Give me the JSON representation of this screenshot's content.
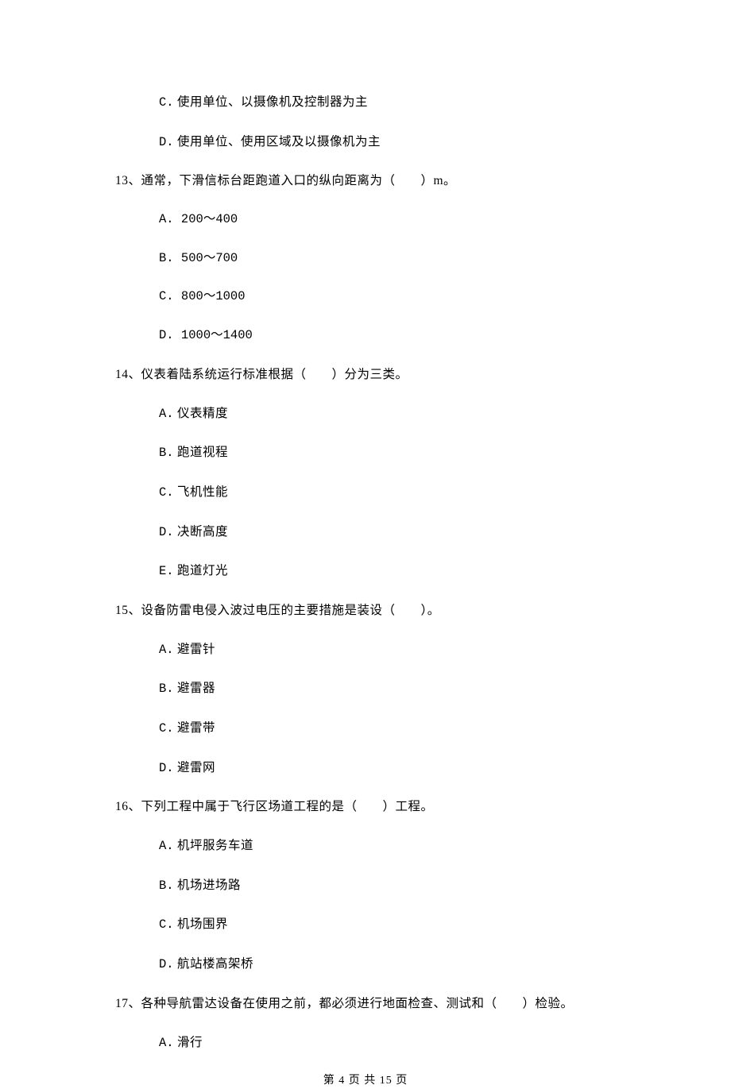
{
  "options_top": [
    {
      "label": "C.",
      "text": "使用单位、以摄像机及控制器为主"
    },
    {
      "label": "D.",
      "text": "使用单位、使用区域及以摄像机为主"
    }
  ],
  "q13": {
    "text": "13、通常，下滑信标台距跑道入口的纵向距离为（　　）m。",
    "options": [
      {
        "label": "A.",
        "text": "200～400"
      },
      {
        "label": "B.",
        "text": "500～700"
      },
      {
        "label": "C.",
        "text": "800～1000"
      },
      {
        "label": "D.",
        "text": "1000～1400"
      }
    ]
  },
  "q14": {
    "text": "14、仪表着陆系统运行标准根据（　　）分为三类。",
    "options": [
      {
        "label": "A.",
        "text": "仪表精度"
      },
      {
        "label": "B.",
        "text": "跑道视程"
      },
      {
        "label": "C.",
        "text": "飞机性能"
      },
      {
        "label": "D.",
        "text": "决断高度"
      },
      {
        "label": "E.",
        "text": "跑道灯光"
      }
    ]
  },
  "q15": {
    "text": "15、设备防雷电侵入波过电压的主要措施是装设（　　）。",
    "options": [
      {
        "label": "A.",
        "text": "避雷针"
      },
      {
        "label": "B.",
        "text": "避雷器"
      },
      {
        "label": "C.",
        "text": "避雷带"
      },
      {
        "label": "D.",
        "text": "避雷网"
      }
    ]
  },
  "q16": {
    "text": "16、下列工程中属于飞行区场道工程的是（　　）工程。",
    "options": [
      {
        "label": "A.",
        "text": "机坪服务车道"
      },
      {
        "label": "B.",
        "text": "机场进场路"
      },
      {
        "label": "C.",
        "text": "机场围界"
      },
      {
        "label": "D.",
        "text": "航站楼高架桥"
      }
    ]
  },
  "q17": {
    "text": "17、各种导航雷达设备在使用之前，都必须进行地面检查、测试和（　　）检验。",
    "options": [
      {
        "label": "A.",
        "text": "滑行"
      }
    ]
  },
  "footer": "第 4 页 共 15 页"
}
